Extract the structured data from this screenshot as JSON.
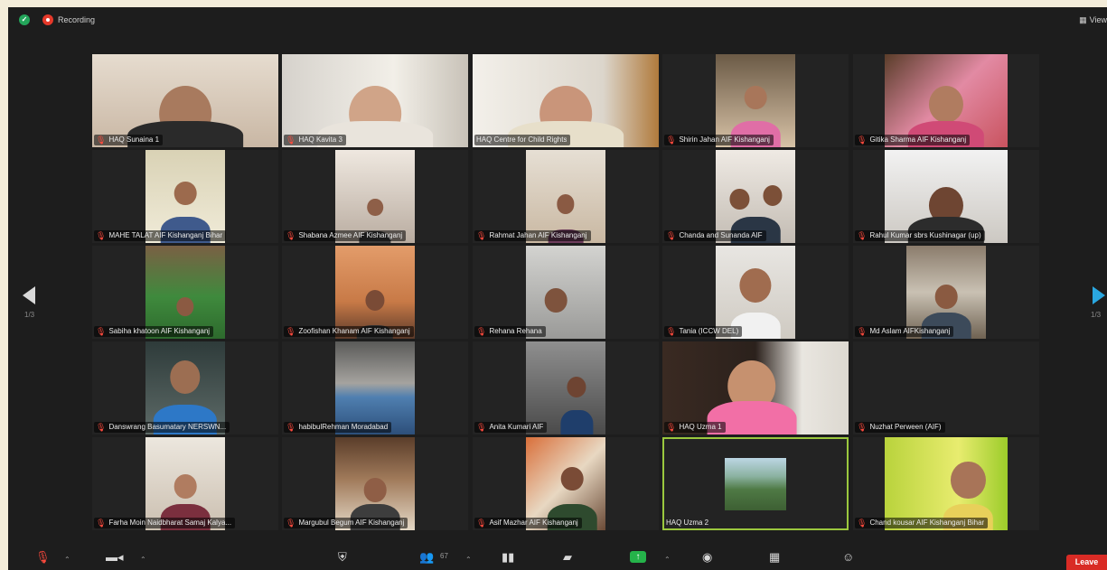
{
  "topbar": {
    "recording_label": "Recording",
    "view_label": "View"
  },
  "participants": [
    "HAQ Sunaina 1",
    "HAQ Kavita 3",
    "HAQ Centre for Child Rights",
    "Shirin Jahan AIF Kishanganj",
    "Gitika Sharma AIF Kishanganj",
    "MAHE TALAT AIF Kishanganj Bihar",
    "Shabana Azmee AIF Kishanganj",
    "Rahmat Jahan AIF Kishanganj",
    "Chanda and Sunanda AIF",
    "Rahul Kumar sbrs Kushinagar (up)",
    "Sabiha khatoon AIF Kishanganj",
    "Zoofishan Khanam AIF Kishanganj",
    "Rehana Rehana",
    "Tania (ICCW DEL)",
    "Md Aslam AIFKishanganj",
    "Danswrang Basumatary NERSWN...",
    "habibulRehman Moradabad",
    "Anita Kumari AIF",
    "HAQ Uzma 1",
    "Nuzhat Perween (AIF)",
    "Farha Moin Naidbharat Samaj Kalya...",
    "Margubul Begum AIF Kishanganj",
    "Asif Mazhar AIF Kishanganj",
    "HAQ Uzma 2",
    "Chand kousar AIF Kishanganj Bihar"
  ],
  "pager": {
    "left": "1/3",
    "right": "1/3"
  },
  "toolbar": {
    "participants_count": "67",
    "leave_label": "Leave"
  },
  "colors": {
    "active_speaker_border": "#9bc83e",
    "share_green": "#25b34a",
    "leave_red": "#d92b25",
    "recording_red": "#e5392a",
    "muted_red": "#ff4a3d"
  }
}
